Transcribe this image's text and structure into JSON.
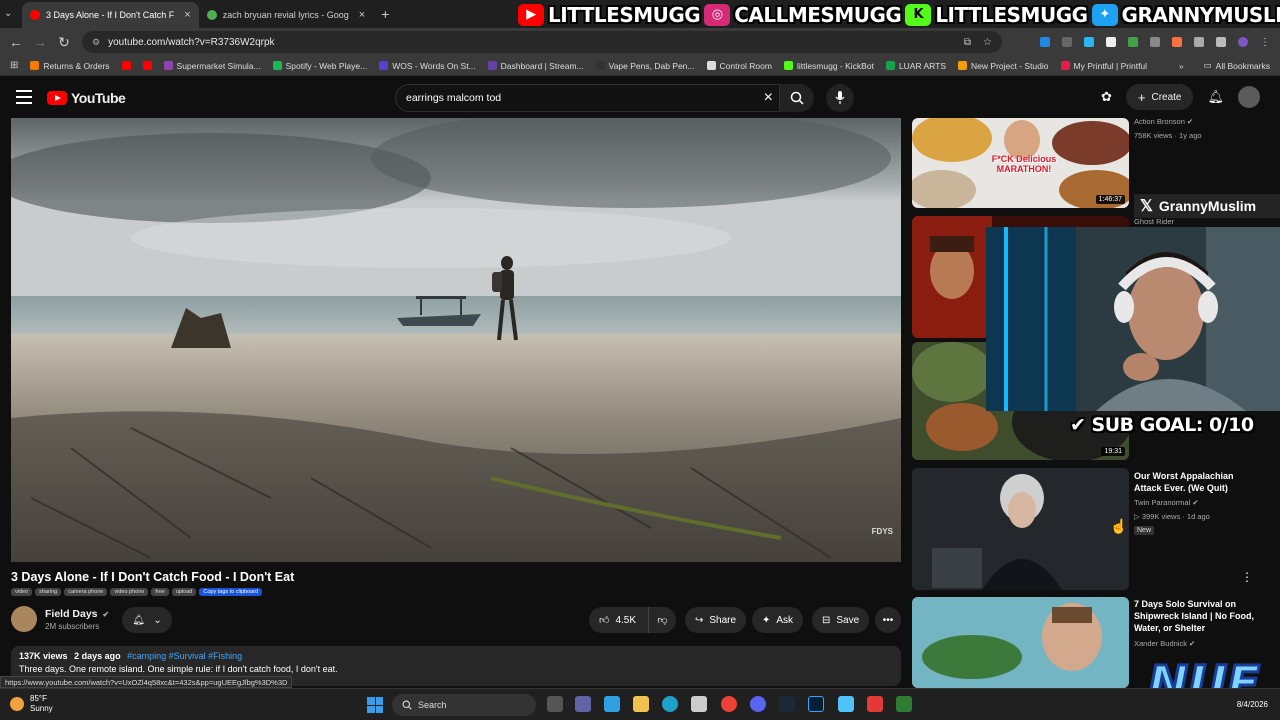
{
  "browser": {
    "tabs": [
      {
        "title": "3 Days Alone - If I Don't Catch F",
        "active": true,
        "favicon_color": "#ff0000"
      },
      {
        "title": "zach bryuan revial lyrics - Goog",
        "active": false,
        "favicon_color": "#4caf50"
      }
    ],
    "url": "youtube.com/watch?v=R3736W2qrpk",
    "bookmarks": [
      {
        "label": "Returns & Orders",
        "color": "#f57c00"
      },
      {
        "label": "",
        "color": "#ff0000"
      },
      {
        "label": "",
        "color": "#ff0000"
      },
      {
        "label": "Supermarket Simula...",
        "color": "#8e44ad"
      },
      {
        "label": "Spotify - Web Playe...",
        "color": "#1db954"
      },
      {
        "label": "WOS - Words On St...",
        "color": "#5b3fd1"
      },
      {
        "label": "Dashboard | Stream...",
        "color": "#6441a5"
      },
      {
        "label": "Vape Pens, Dab Pen...",
        "color": "#333333"
      },
      {
        "label": "Control Room",
        "color": "#dddddd"
      },
      {
        "label": "littlesmugg - KickBot",
        "color": "#53fc18"
      },
      {
        "label": "LUAR ARTS",
        "color": "#16a34a"
      },
      {
        "label": "New Project - Studio",
        "color": "#f59e0b"
      },
      {
        "label": "My Printful | Printful",
        "color": "#e11d48"
      }
    ],
    "all_bookmarks": "All Bookmarks",
    "status_url": "https://www.youtube.com/watch?v=UxOZl4q58xc&t=432s&pp=ugUEEgJlbg%3D%3D"
  },
  "stream_banner": {
    "items": [
      {
        "handle": "LITTLESMUGG",
        "icon": "youtube-icon",
        "color": "#ff0000"
      },
      {
        "handle": "CALLMESMUGG",
        "icon": "instagram-icon",
        "color": "#d62976"
      },
      {
        "handle": "LITTLESMUGG",
        "icon": "kick-icon",
        "color": "#53fc18"
      },
      {
        "handle": "GRANNYMUSLIM",
        "icon": "twitter-icon",
        "color": "#1da1f2"
      }
    ]
  },
  "youtube": {
    "logo_text": "YouTube",
    "search_query": "earrings malcom tod",
    "create_label": "Create"
  },
  "video": {
    "title": "3 Days Alone - If I Don't Catch Food - I Don't Eat",
    "tags": [
      "video",
      "sharing",
      "camera phone",
      "video phone",
      "free",
      "upload"
    ],
    "copy_tags": "Copy tags to clipboard",
    "channel": "Field Days",
    "subscribers": "2M subscribers",
    "likes": "4.5K",
    "share_label": "Share",
    "ask_label": "Ask",
    "save_label": "Save",
    "views": "137K views",
    "age": "2 days ago",
    "hashtags": "#camping #Survival #Fishing",
    "description": "Three days. One remote island. One simple rule: if I don't catch food, I don't eat.",
    "watermark": "FDYS"
  },
  "recommendations": [
    {
      "channel": "Action Bronson",
      "meta": "758K views · 1y ago",
      "duration": "1:46:37",
      "thumb_text": "F*CK Delicious MARATHON!"
    },
    {
      "channel": "Ghost Rider",
      "meta": "",
      "duration": "",
      "thumb_text": ""
    },
    {
      "channel": "",
      "meta": "",
      "duration": "19:31",
      "thumb_text": ""
    },
    {
      "title": "Our Worst Appalachian Attack Ever. (We Quit)",
      "channel": "Twin Paranormal",
      "meta": "399K views · 1d ago",
      "badge": "New",
      "duration": ""
    },
    {
      "title": "7 Days Solo Survival on Shipwreck Island | No Food, Water, or Shelter",
      "channel": "Xander Budnick",
      "meta": "",
      "duration": ""
    }
  ],
  "overlays": {
    "x_handle": "GrannyMuslim",
    "sub_goal": "SUB GOAL: 0/10",
    "brand": "NUE"
  },
  "taskbar": {
    "temperature": "85°F",
    "condition": "Sunny",
    "search_label": "Search",
    "date": "8/4/2026"
  }
}
